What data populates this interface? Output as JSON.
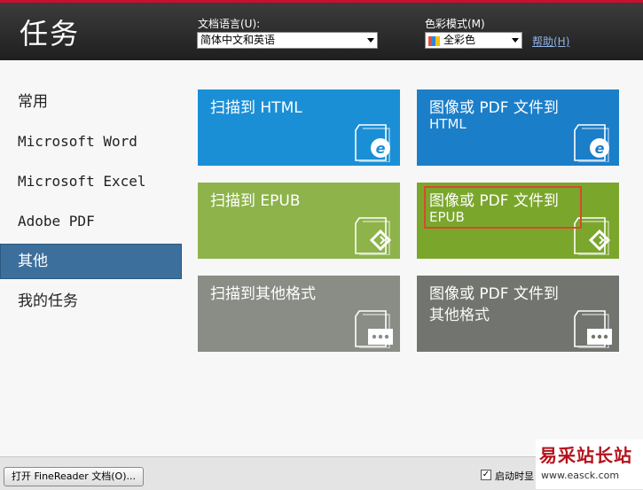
{
  "header": {
    "title": "任务",
    "language_label": "文档语言(U):",
    "language_value": "简体中文和英语",
    "color_label": "色彩模式(M)",
    "color_value": "全彩色",
    "help_label": "帮助(H)"
  },
  "sidebar": {
    "items": [
      {
        "label": "常用"
      },
      {
        "label": "Microsoft Word"
      },
      {
        "label": "Microsoft Excel"
      },
      {
        "label": "Adobe PDF"
      },
      {
        "label": "其他"
      },
      {
        "label": "我的任务"
      }
    ],
    "active_index": 4
  },
  "tiles": [
    {
      "line1": "扫描到 HTML",
      "line2": "",
      "icon": "html-ie-icon",
      "color": "#1b8fd6"
    },
    {
      "line1": "图像或 PDF 文件到",
      "line2": "HTML",
      "icon": "html-ie-icon",
      "color": "#1b7ec9"
    },
    {
      "line1": "扫描到 EPUB",
      "line2": "",
      "icon": "epub-icon",
      "color": "#8db34a"
    },
    {
      "line1": "图像或 PDF 文件到",
      "line2": "EPUB",
      "icon": "epub-icon",
      "color": "#7ba62c"
    },
    {
      "line1": "扫描到其他格式",
      "line2": "",
      "icon": "more-icon",
      "color": "#8a8c86"
    },
    {
      "line1": "图像或 PDF 文件到",
      "line2": "其他格式",
      "icon": "more-icon",
      "color": "#72756f"
    }
  ],
  "bottom": {
    "open_button": "打开 FineReader 文档(O)...",
    "startup_checkbox": "启动时显",
    "startup_checked": true
  },
  "watermark": {
    "line1": "易采站长站",
    "line2": "www.easck.com"
  }
}
